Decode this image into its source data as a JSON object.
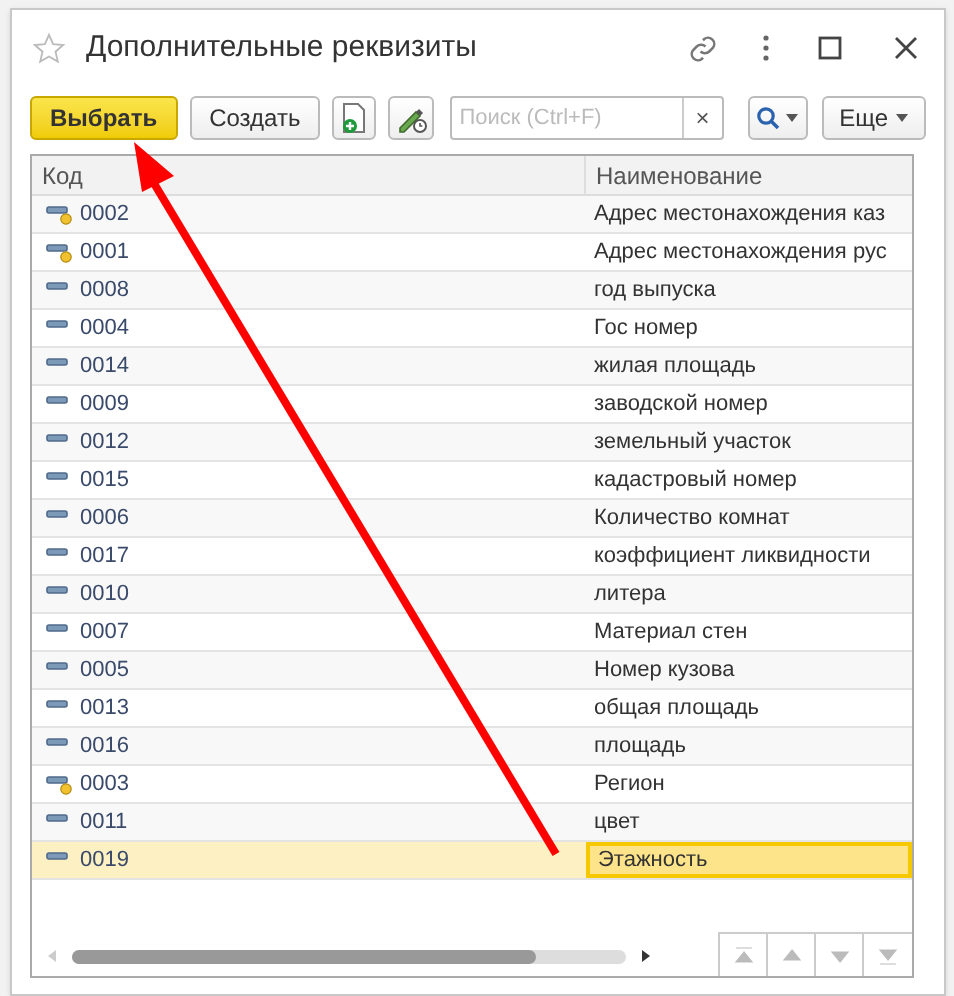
{
  "window": {
    "title": "Дополнительные реквизиты"
  },
  "toolbar": {
    "select_button": "Выбрать",
    "create_button": "Создать",
    "search": {
      "placeholder": "Поиск (Ctrl+F)"
    },
    "clear": "×",
    "more_button": "Еще"
  },
  "table": {
    "columns": [
      "Код",
      "Наименование"
    ],
    "rows": [
      {
        "code": "0002",
        "name": "Адрес местонахождения каз",
        "kind": "dot",
        "selected": false
      },
      {
        "code": "0001",
        "name": "Адрес местонахождения рус",
        "kind": "dot",
        "selected": false
      },
      {
        "code": "0008",
        "name": "год выпуска",
        "kind": "plain",
        "selected": false
      },
      {
        "code": "0004",
        "name": "Гос номер",
        "kind": "plain",
        "selected": false
      },
      {
        "code": "0014",
        "name": "жилая площадь",
        "kind": "plain",
        "selected": false
      },
      {
        "code": "0009",
        "name": "заводской номер",
        "kind": "plain",
        "selected": false
      },
      {
        "code": "0012",
        "name": "земельный участок",
        "kind": "plain",
        "selected": false
      },
      {
        "code": "0015",
        "name": "кадастровый номер",
        "kind": "plain",
        "selected": false
      },
      {
        "code": "0006",
        "name": "Количество комнат",
        "kind": "plain",
        "selected": false
      },
      {
        "code": "0017",
        "name": "коэффициент ликвидности",
        "kind": "plain",
        "selected": false
      },
      {
        "code": "0010",
        "name": "литера",
        "kind": "plain",
        "selected": false
      },
      {
        "code": "0007",
        "name": "Материал стен",
        "kind": "plain",
        "selected": false
      },
      {
        "code": "0005",
        "name": "Номер кузова",
        "kind": "plain",
        "selected": false
      },
      {
        "code": "0013",
        "name": "общая площадь",
        "kind": "plain",
        "selected": false
      },
      {
        "code": "0016",
        "name": "площадь",
        "kind": "plain",
        "selected": false
      },
      {
        "code": "0003",
        "name": "Регион",
        "kind": "dot",
        "selected": false
      },
      {
        "code": "0011",
        "name": "цвет",
        "kind": "plain",
        "selected": false
      },
      {
        "code": "0019",
        "name": "Этажность",
        "kind": "plain",
        "selected": true
      }
    ]
  }
}
